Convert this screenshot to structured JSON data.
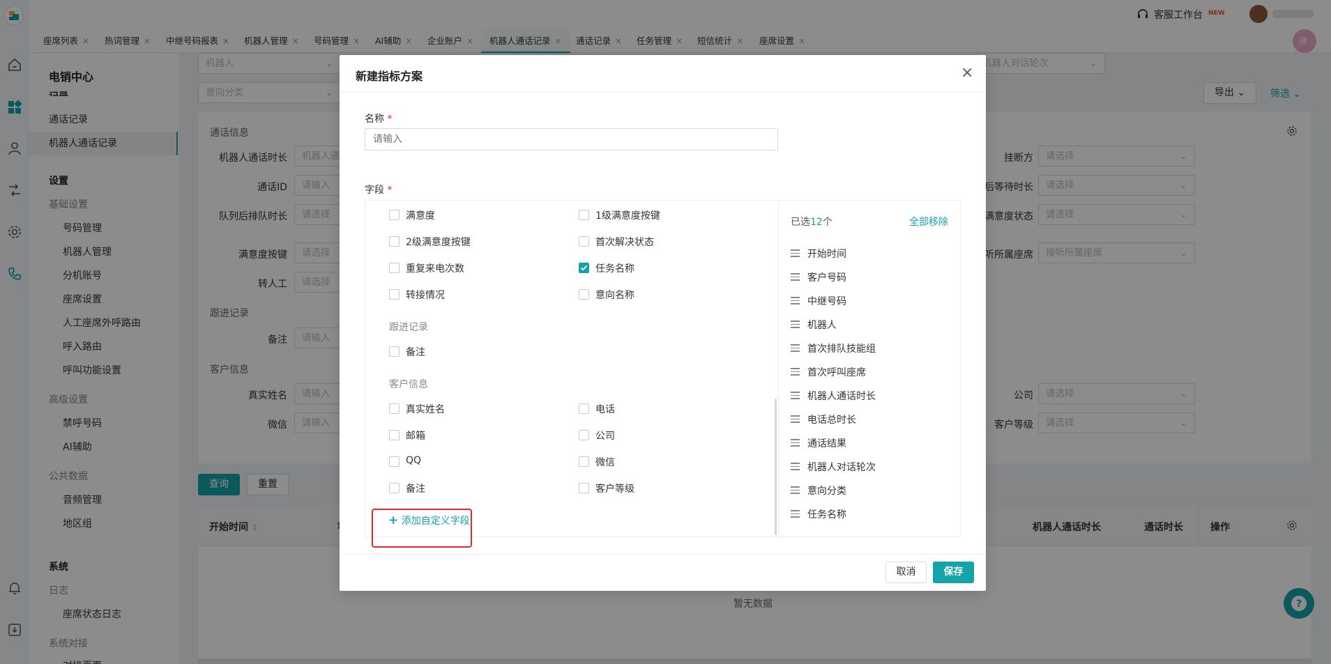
{
  "topbar": {
    "workbench_label": "客服工作台",
    "new_badge": "NEW"
  },
  "tabs": [
    {
      "label": "座席列表"
    },
    {
      "label": "热词管理"
    },
    {
      "label": "中继号码报表"
    },
    {
      "label": "机器人管理"
    },
    {
      "label": "号码管理"
    },
    {
      "label": "AI辅助"
    },
    {
      "label": "企业账户"
    },
    {
      "label": "机器人通话记录"
    },
    {
      "label": "通话记录"
    },
    {
      "label": "任务管理"
    },
    {
      "label": "短信统计"
    },
    {
      "label": "座席设置"
    }
  ],
  "tab_close": "×",
  "sidemenu": {
    "title": "电销中心",
    "cut_item": "记录",
    "items": {
      "call_records": "通话记录",
      "robot_call_records": "机器人通话记录",
      "settings": "设置",
      "basic_settings": "基础设置",
      "number_mgmt": "号码管理",
      "robot_mgmt": "机器人管理",
      "extension": "分机账号",
      "seat_settings": "座席设置",
      "manual_outbound_route": "人工座席外呼路由",
      "inbound_route": "呼入路由",
      "call_function_settings": "呼叫功能设置",
      "advanced_settings": "高级设置",
      "blocked_numbers": "禁呼号码",
      "ai_assist": "AI辅助",
      "public_data": "公共数据",
      "audio_mgmt": "音频管理",
      "region_group": "地区组",
      "system": "系统",
      "log": "日志",
      "seat_status_log": "座席状态日志",
      "system_integration": "系统对接",
      "integration_page": "对接页面"
    }
  },
  "main": {
    "top_filters": {
      "robot_placeholder": "机器人",
      "intent_placeholder": "意向分类",
      "robot_turns_placeholder": "机器人对话轮次"
    },
    "export_label": "导出",
    "filter_label": "筛选",
    "sections": {
      "call_info": "通话信息",
      "follow_up": "跟进记录",
      "customer_info": "客户信息"
    },
    "fields_left": [
      {
        "label": "机器人通话时长",
        "placeholder": "机器人通"
      },
      {
        "label": "通话ID",
        "placeholder": "请输入"
      },
      {
        "label": "队列后排队时长",
        "placeholder": "请选择"
      },
      {
        "label": "满意度按键",
        "placeholder": "请选择"
      },
      {
        "label": "转人工",
        "placeholder": "请选择"
      },
      {
        "label": "备注",
        "placeholder": "请输入"
      },
      {
        "label": "真实姓名",
        "placeholder": "请输入"
      },
      {
        "label": "微信",
        "placeholder": "请输入"
      }
    ],
    "fields_right": [
      {
        "label": "挂断方",
        "placeholder": "请选择"
      },
      {
        "label": "后等待时长",
        "placeholder": "请选择"
      },
      {
        "label": "满意度状态",
        "placeholder": "请选择"
      },
      {
        "label": "听所属座席",
        "placeholder": "接听所属座席"
      },
      {
        "label": "公司",
        "placeholder": "请选择"
      },
      {
        "label": "客户等级",
        "placeholder": "请选择"
      }
    ],
    "query_button": "查询",
    "reset_button": "重置",
    "table": {
      "col_start_time": "开始时间",
      "col_cut": "客",
      "col_robot_duration": "机器人通话时长",
      "col_call_duration": "通话时长",
      "col_actions": "操作",
      "empty_text": "暂无数据"
    }
  },
  "modal": {
    "title": "新建指标方案",
    "close": "×",
    "name_label": "名称",
    "required_mark": "*",
    "name_placeholder": "请输入",
    "fields_label": "字段",
    "options": [
      {
        "label": "满意度",
        "checked": false
      },
      {
        "label": "1级满意度按键",
        "checked": false
      },
      {
        "label": "2级满意度按键",
        "checked": false
      },
      {
        "label": "首次解决状态",
        "checked": false
      },
      {
        "label": "重复来电次数",
        "checked": false
      },
      {
        "label": "任务名称",
        "checked": true
      },
      {
        "label": "转接情况",
        "checked": false
      },
      {
        "label": "意向名称",
        "checked": false
      }
    ],
    "group_follow_up": "跟进记录",
    "follow_up_options": [
      {
        "label": "备注",
        "checked": false
      }
    ],
    "group_customer": "客户信息",
    "customer_options": [
      {
        "label": "真实姓名",
        "checked": false
      },
      {
        "label": "电话",
        "checked": false
      },
      {
        "label": "邮箱",
        "checked": false
      },
      {
        "label": "公司",
        "checked": false
      },
      {
        "label": "QQ",
        "checked": false
      },
      {
        "label": "微信",
        "checked": false
      },
      {
        "label": "备注",
        "checked": false
      },
      {
        "label": "客户等级",
        "checked": false
      }
    ],
    "add_custom_field": "添加自定义字段",
    "selected_prefix": "已选",
    "selected_count": "12",
    "selected_suffix": "个",
    "remove_all": "全部移除",
    "selected_items": [
      "开始时间",
      "客户号码",
      "中继号码",
      "机器人",
      "首次排队技能组",
      "首次呼叫座席",
      "机器人通话时长",
      "电话总时长",
      "通话结果",
      "机器人对话轮次",
      "意向分类",
      "任务名称"
    ],
    "cancel_button": "取消",
    "save_button": "保存"
  },
  "colors": {
    "accent": "#14a3a8",
    "highlight_red": "#e6262b",
    "overlay": "rgba(0,0,0,0.45)"
  }
}
